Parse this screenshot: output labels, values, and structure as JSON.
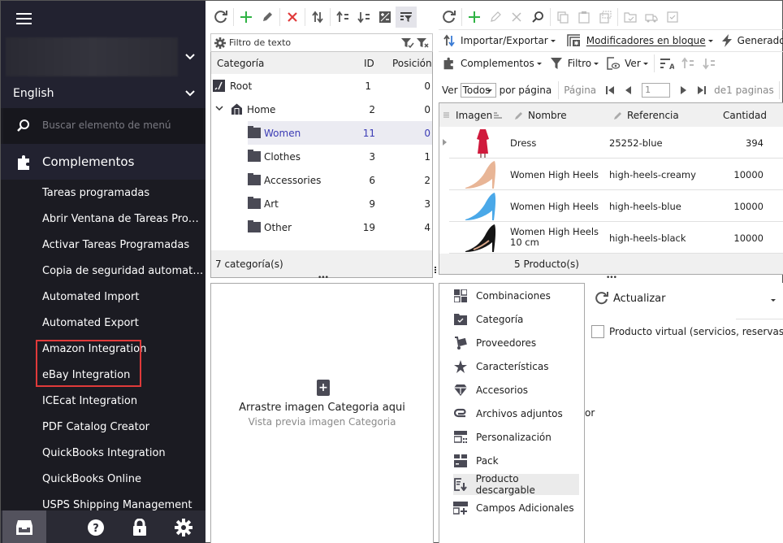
{
  "sidebar": {
    "language": "English",
    "search_placeholder": "Buscar elemento de menú",
    "section": "Complementos",
    "items": [
      {
        "label": "Tareas programadas"
      },
      {
        "label": "Abrir Ventana de Tareas Programadas"
      },
      {
        "label": "Activar Tareas Programadas"
      },
      {
        "label": "Copia de seguridad automatizada"
      },
      {
        "label": "Automated Import"
      },
      {
        "label": "Automated Export"
      },
      {
        "label": "Amazon Integration"
      },
      {
        "label": "eBay Integration"
      },
      {
        "label": "ICEcat Integration"
      },
      {
        "label": "PDF Catalog Creator"
      },
      {
        "label": "QuickBooks Integration"
      },
      {
        "label": "QuickBooks Online"
      },
      {
        "label": "USPS Shipping Management"
      }
    ],
    "bottom_icons": [
      "store-icon",
      "help-icon",
      "lock-icon",
      "settings-icon"
    ]
  },
  "categories": {
    "filter_placeholder": "Filtro de texto",
    "columns": {
      "name": "Categoría",
      "id": "ID",
      "position": "Posición"
    },
    "rows": [
      {
        "name": "Root",
        "id": "1",
        "position": "0"
      },
      {
        "name": "Home",
        "id": "2",
        "position": "0"
      },
      {
        "name": "Women",
        "id": "11",
        "position": "0"
      },
      {
        "name": "Clothes",
        "id": "3",
        "position": "1"
      },
      {
        "name": "Accessories",
        "id": "6",
        "position": "2"
      },
      {
        "name": "Art",
        "id": "9",
        "position": "3"
      },
      {
        "name": "Other",
        "id": "19",
        "position": "4"
      }
    ],
    "footer": "7 categoría(s)",
    "selected": "Women"
  },
  "image_drop": {
    "title": "Arrastre imagen Categoria aqui",
    "subtitle": "Vista previa imagen Categoria"
  },
  "products_toolbar": {
    "import_export": "Importar/Exportar",
    "bulk_modifiers": "Modificadores en bloque",
    "generators": "Generadores",
    "addons": "Complementos",
    "filter": "Filtro",
    "view": "Ver",
    "show_label": "Ver",
    "per_page_value": "Todos",
    "per_page_label": "por página",
    "page_label": "Página",
    "page_value": "1",
    "page_total": "de1 paginas"
  },
  "products": {
    "columns": {
      "image": "Imagen",
      "name": "Nombre",
      "reference": "Referencia",
      "quantity": "Cantidad"
    },
    "rows": [
      {
        "name": "Dress",
        "reference": "25252-blue",
        "quantity": "394",
        "thumb": "red-dress"
      },
      {
        "name": "Women High Heels",
        "reference": "high-heels-creamy",
        "quantity": "10000",
        "thumb": "beige-heel"
      },
      {
        "name": "Women High Heels",
        "reference": "high-heels-blue",
        "quantity": "10000",
        "thumb": "blue-heel"
      },
      {
        "name": "Women High Heels 10 cm",
        "reference": "high-heels-black",
        "quantity": "10000",
        "thumb": "black-heel"
      }
    ],
    "footer": "5 Producto(s)"
  },
  "detail_menu": {
    "items": [
      {
        "label": "Combinaciones",
        "icon": "grid-icon"
      },
      {
        "label": "Categoría",
        "icon": "folder-check-icon"
      },
      {
        "label": "Proveedores",
        "icon": "hand-truck-icon"
      },
      {
        "label": "Características",
        "icon": "star-icon"
      },
      {
        "label": "Accesorios",
        "icon": "diamond-icon"
      },
      {
        "label": "Archivos adjuntos",
        "icon": "attachment-icon"
      },
      {
        "label": "Personalización",
        "icon": "customization-icon"
      },
      {
        "label": "Pack",
        "icon": "pack-icon"
      },
      {
        "label": "Producto descargable",
        "icon": "download-file-icon"
      },
      {
        "label": "Campos Adicionales",
        "icon": "add-fields-icon"
      }
    ],
    "hovered": "Producto descargable"
  },
  "detail_panel": {
    "refresh": "Actualizar",
    "virtual_product": "Producto virtual (servicios, reservas y descargas)",
    "virtual_checked": false,
    "fragment": "or"
  },
  "colors": {
    "sidebar_bg": "#1b1b22",
    "highlight": "#e03a3a",
    "add_green": "#2fb344",
    "delete_red": "#e03a3a",
    "selected_text": "#3b3bb5"
  }
}
